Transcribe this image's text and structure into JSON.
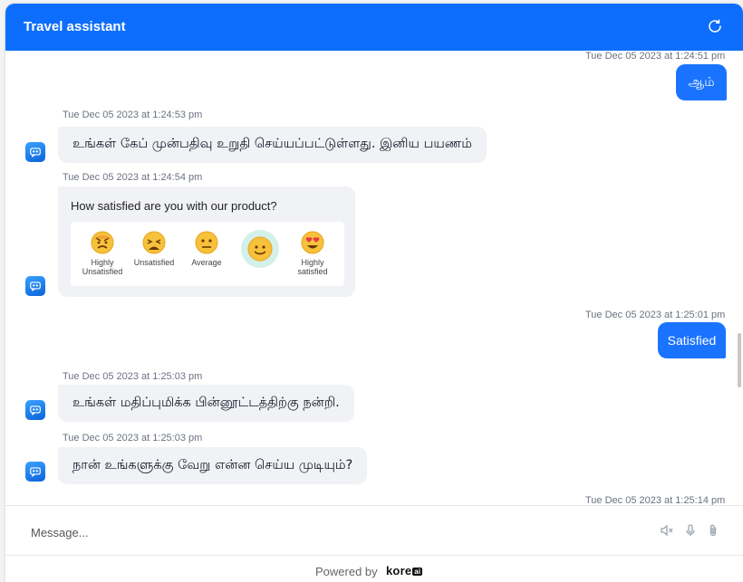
{
  "header": {
    "title": "Travel assistant"
  },
  "messages": {
    "m1_time": "Tue Dec 05 2023 at 1:24:51 pm",
    "m1_text": "ஆம்",
    "m2_time": "Tue Dec 05 2023 at 1:24:53 pm",
    "m2_text": "உங்கள் கேப் முன்பதிவு உறுதி செய்யப்பட்டுள்ளது. இனிய பயணம்",
    "m3_time": "Tue Dec 05 2023 at 1:24:54 pm",
    "m4_time": "Tue Dec 05 2023 at 1:25:01 pm",
    "m4_text": "Satisfied",
    "m5_time": "Tue Dec 05 2023 at 1:25:03 pm",
    "m5_text": "உங்கள் மதிப்புமிக்க பின்னூட்டத்திற்கு நன்றி.",
    "m6_time": "Tue Dec 05 2023 at 1:25:03 pm",
    "m6_text": "நான் உங்களுக்கு வேறு என்ன செய்ய முடியும்?",
    "m7_time": "Tue Dec 05 2023 at 1:25:14 pm"
  },
  "feedback": {
    "question": "How satisfied are you with our product?",
    "options": [
      {
        "line1": "Highly",
        "line2": "Unsatisfied"
      },
      {
        "line1": "Unsatisfied",
        "line2": ""
      },
      {
        "line1": "Average",
        "line2": ""
      },
      {
        "line1": "",
        "line2": ""
      },
      {
        "line1": "Highly",
        "line2": "satisfied"
      }
    ],
    "selected_index": 3
  },
  "composer": {
    "placeholder": "Message..."
  },
  "footer": {
    "powered_by": "Powered by",
    "brand": "kore",
    "brand_suffix": "ai"
  },
  "colors": {
    "header": "#0d6efd",
    "user_bubble": "#1a73ff",
    "bot_bubble": "#f1f2f5",
    "selected_emoji_ring": "#d4f0ea"
  },
  "icons": {
    "header_right": "refresh-icon",
    "bot": "chat-bot-icon",
    "tools": [
      "speaker-mute-icon",
      "microphone-icon",
      "paperclip-icon"
    ]
  }
}
